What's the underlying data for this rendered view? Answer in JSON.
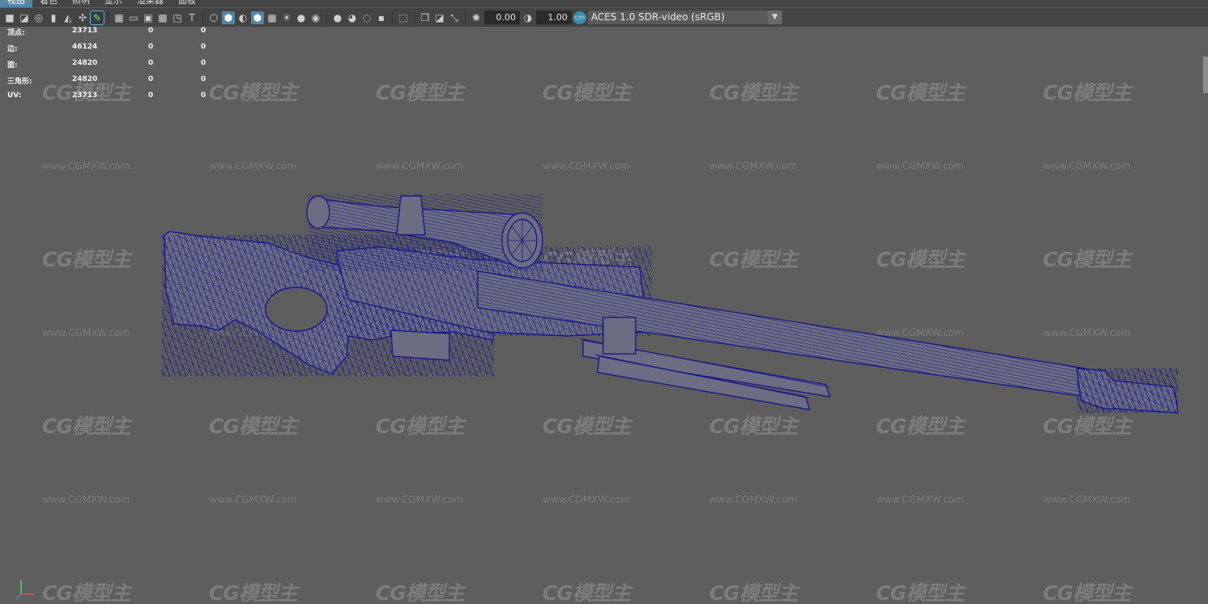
{
  "menu": {
    "items": [
      {
        "label": "视图",
        "active": true
      },
      {
        "label": "着色",
        "active": false
      },
      {
        "label": "照明",
        "active": false
      },
      {
        "label": "显示",
        "active": false
      },
      {
        "label": "渲染器",
        "active": false
      },
      {
        "label": "面板",
        "active": false
      }
    ]
  },
  "toolbar": {
    "exposure": "0.00",
    "gamma": "1.00",
    "color_space": "ACES 1.0 SDR-video (sRGB)",
    "icons": [
      "camera-select-icon",
      "lock-camera-icon",
      "camera-attributes-icon",
      "bookmark-icon",
      "image-plane-icon",
      "2d-pan-zoom-icon",
      "grease-pencil-icon",
      "grid-icon",
      "film-gate-icon",
      "resolution-gate-icon",
      "gate-mask-icon",
      "field-chart-icon",
      "safe-action-icon",
      "safe-title-icon",
      "wireframe-icon",
      "smooth-shade-icon",
      "default-material-icon",
      "wireframe-on-shaded-icon",
      "textured-icon",
      "lights-icon",
      "shadows-icon",
      "screen-space-ao-icon",
      "motion-blur-icon",
      "anti-aliasing-icon",
      "depth-of-field-icon",
      "isolate-select-icon",
      "xray-icon",
      "xray-joints-icon",
      "xray-components-icon",
      "exposure-icon",
      "gamma-icon",
      "color-management-icon"
    ]
  },
  "stats": {
    "rows": [
      {
        "label": "顶点:",
        "v1": "23713",
        "v2": "0",
        "v3": "0"
      },
      {
        "label": "边:",
        "v1": "46124",
        "v2": "0",
        "v3": "0"
      },
      {
        "label": "面:",
        "v1": "24820",
        "v2": "0",
        "v3": "0"
      },
      {
        "label": "三角形:",
        "v1": "24820",
        "v2": "0",
        "v3": "0"
      },
      {
        "label": "UV:",
        "v1": "23713",
        "v2": "0",
        "v3": "0"
      }
    ]
  },
  "watermark": {
    "logo": "CG模型主",
    "url": "www.CGMXW.com"
  },
  "colors": {
    "viewport_bg": "#5e5e5e",
    "wireframe": "#1b1a8a",
    "active_accent": "#5285a6"
  }
}
